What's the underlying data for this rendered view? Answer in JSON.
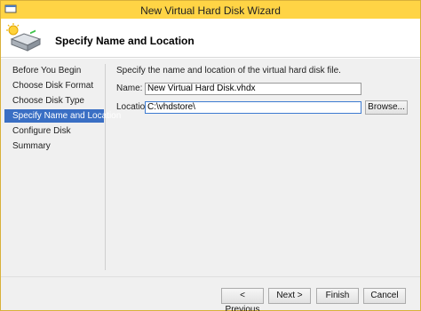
{
  "window": {
    "title": "New Virtual Hard Disk Wizard",
    "title_icon": "wizard-icon",
    "accent_color": "#ffd445"
  },
  "header": {
    "title": "Specify Name and Location",
    "icon": "hard-disk-icon"
  },
  "sidebar": {
    "items": [
      {
        "label": "Before You Begin",
        "active": false
      },
      {
        "label": "Choose Disk Format",
        "active": false
      },
      {
        "label": "Choose Disk Type",
        "active": false
      },
      {
        "label": "Specify Name and Location",
        "active": true
      },
      {
        "label": "Configure Disk",
        "active": false
      },
      {
        "label": "Summary",
        "active": false
      }
    ]
  },
  "main": {
    "description": "Specify the name and location of the virtual hard disk file.",
    "name_label": "Name:",
    "name_value": "New Virtual Hard Disk.vhdx",
    "location_label": "Location:",
    "location_value": "C:\\vhdstore\\",
    "browse_label": "Browse..."
  },
  "footer": {
    "previous_label": "< Previous",
    "next_label": "Next >",
    "finish_label": "Finish",
    "cancel_label": "Cancel"
  }
}
